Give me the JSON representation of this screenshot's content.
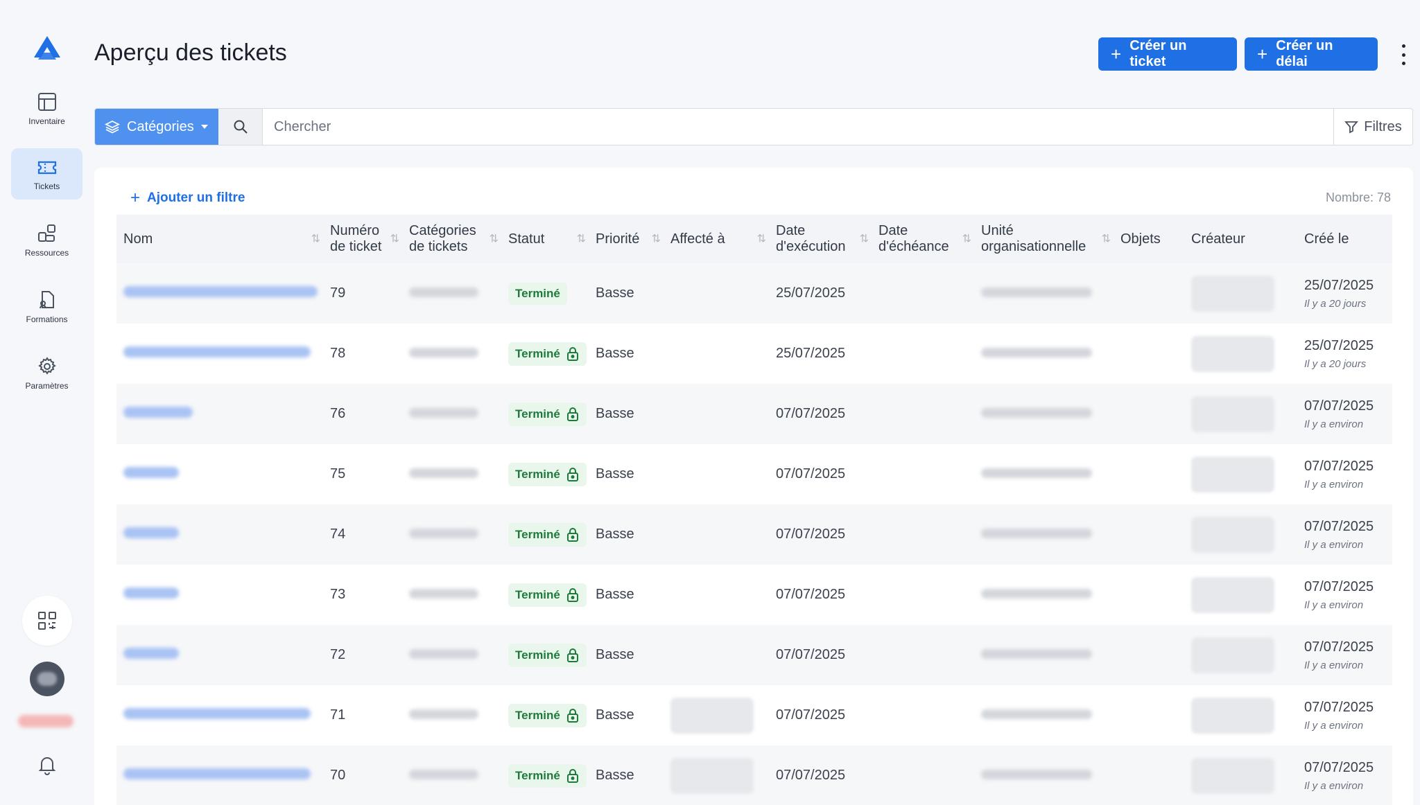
{
  "page": {
    "title": "Aperçu des tickets"
  },
  "sidebar": {
    "items": [
      {
        "label": "Inventaire",
        "icon": "inventory-grid-icon"
      },
      {
        "label": "Tickets",
        "icon": "ticket-icon",
        "active": true
      },
      {
        "label": "Ressources",
        "icon": "resources-icon"
      },
      {
        "label": "Formations",
        "icon": "formations-icon"
      },
      {
        "label": "Paramètres",
        "icon": "gear-icon"
      }
    ]
  },
  "header": {
    "create_ticket": "Créer un ticket",
    "create_delay": "Créer un délai"
  },
  "search": {
    "categories_label": "Catégories",
    "placeholder": "Chercher",
    "filters_label": "Filtres"
  },
  "table": {
    "add_filter": "Ajouter un filtre",
    "count": "Nombre: 78",
    "columns": [
      "Nom",
      "Numéro de ticket",
      "Catégories de tickets",
      "Statut",
      "Priorité",
      "Affecté à",
      "Date d'exécution",
      "Date d'échéance",
      "Unité organisationnelle",
      "Objets",
      "Créateur",
      "Créé le"
    ],
    "rows": [
      {
        "number": "79",
        "status": "Terminé",
        "locked": false,
        "priority": "Basse",
        "exec_date": "25/07/2025",
        "created": "25/07/2025",
        "relative": "Il y a 20 jours",
        "assigned": false
      },
      {
        "number": "78",
        "status": "Terminé",
        "locked": true,
        "priority": "Basse",
        "exec_date": "25/07/2025",
        "created": "25/07/2025",
        "relative": "Il y a 20 jours",
        "assigned": false
      },
      {
        "number": "76",
        "status": "Terminé",
        "locked": true,
        "priority": "Basse",
        "exec_date": "07/07/2025",
        "created": "07/07/2025",
        "relative": "Il y a environ",
        "assigned": false
      },
      {
        "number": "75",
        "status": "Terminé",
        "locked": true,
        "priority": "Basse",
        "exec_date": "07/07/2025",
        "created": "07/07/2025",
        "relative": "Il y a environ",
        "assigned": false
      },
      {
        "number": "74",
        "status": "Terminé",
        "locked": true,
        "priority": "Basse",
        "exec_date": "07/07/2025",
        "created": "07/07/2025",
        "relative": "Il y a environ",
        "assigned": false
      },
      {
        "number": "73",
        "status": "Terminé",
        "locked": true,
        "priority": "Basse",
        "exec_date": "07/07/2025",
        "created": "07/07/2025",
        "relative": "Il y a environ",
        "assigned": false
      },
      {
        "number": "72",
        "status": "Terminé",
        "locked": true,
        "priority": "Basse",
        "exec_date": "07/07/2025",
        "created": "07/07/2025",
        "relative": "Il y a environ",
        "assigned": false
      },
      {
        "number": "71",
        "status": "Terminé",
        "locked": true,
        "priority": "Basse",
        "exec_date": "07/07/2025",
        "created": "07/07/2025",
        "relative": "Il y a environ",
        "assigned": true
      },
      {
        "number": "70",
        "status": "Terminé",
        "locked": true,
        "priority": "Basse",
        "exec_date": "07/07/2025",
        "created": "07/07/2025",
        "relative": "Il y a environ",
        "assigned": true
      }
    ]
  },
  "colors": {
    "primary": "#1f6fe5",
    "status_bg": "#e9f6ec",
    "status_text": "#1e7a3b"
  }
}
